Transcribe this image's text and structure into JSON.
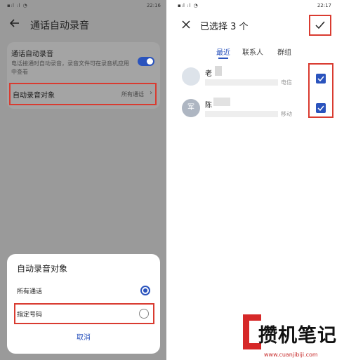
{
  "left_screen": {
    "status_right": "22:16",
    "title": "通话自动录音",
    "auto_record": {
      "title": "通话自动录音",
      "description": "电话接通时自动录音，录音文件可在录音机应用中查看",
      "enabled": true
    },
    "record_target": {
      "label": "自动录音对象",
      "value": "所有通话"
    },
    "sheet": {
      "title": "自动录音对象",
      "options": [
        {
          "label": "所有通话",
          "selected": true
        },
        {
          "label": "指定号码",
          "selected": false
        }
      ],
      "cancel": "取消"
    }
  },
  "right_screen": {
    "status_right": "22:17",
    "title": "已选择 3 个",
    "tabs": [
      "最近",
      "联系人",
      "群组"
    ],
    "contacts": [
      {
        "name": "老",
        "avatar": "",
        "carrier": "电信",
        "checked": true
      },
      {
        "name": "陈",
        "avatar": "军",
        "carrier": "移动",
        "checked": true
      }
    ]
  },
  "watermark": {
    "text": "攒机笔记",
    "url": "www.cuanjibiji.com"
  },
  "colors": {
    "accent": "#2a53bd",
    "highlight": "#d93b30"
  }
}
